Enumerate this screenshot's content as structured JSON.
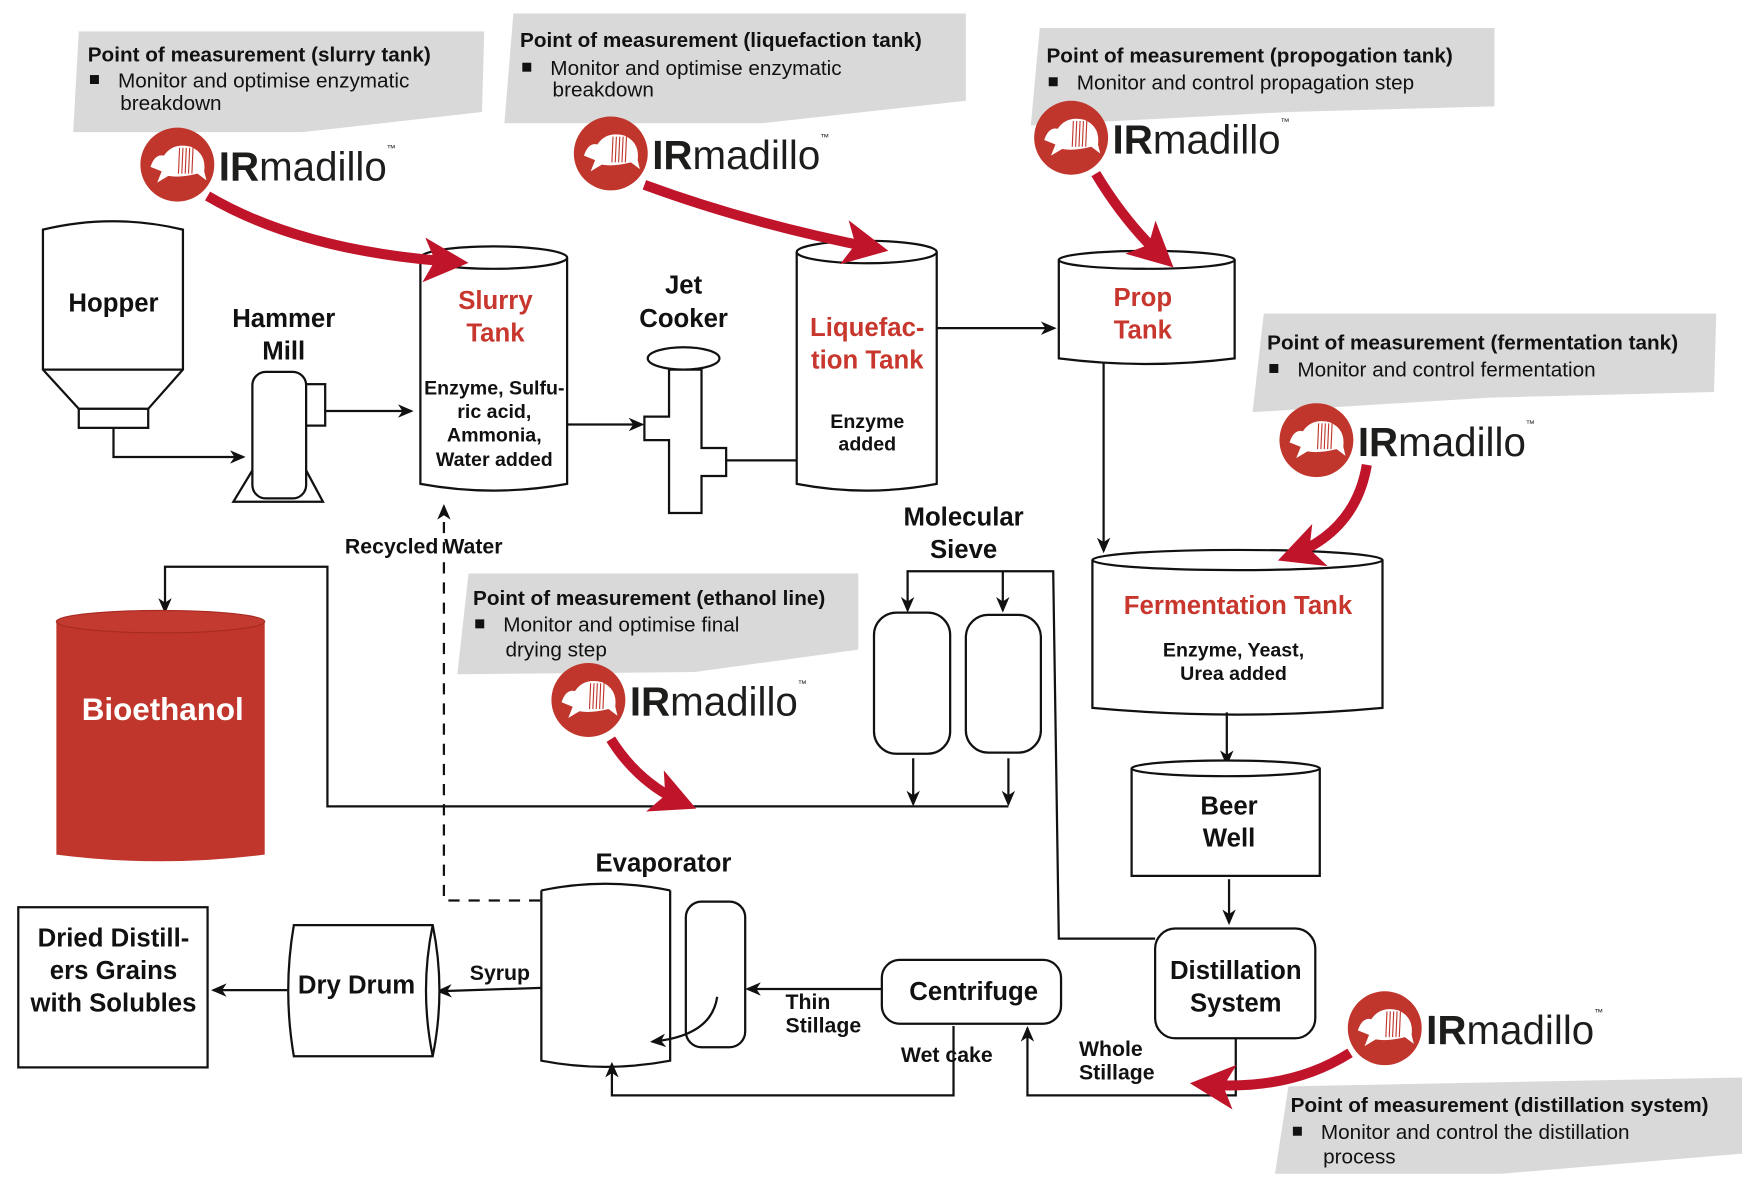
{
  "colors": {
    "brand_red": "#c0362c",
    "arrow_red": "#c0142a",
    "callout_gray": "#d9d9d9",
    "tank_label_red": "#c8372d"
  },
  "brand": {
    "name_bold": "IR",
    "name_rest": "madillo",
    "trademark": "™"
  },
  "callouts": {
    "slurry": {
      "title": "Point of measurement (slurry tank)",
      "lines": [
        "Monitor and optimise enzymatic",
        "breakdown"
      ]
    },
    "liquefaction": {
      "title": "Point of measurement (liquefaction tank)",
      "lines": [
        "Monitor and optimise enzymatic",
        "breakdown"
      ]
    },
    "propagation": {
      "title": "Point of measurement (propogation tank)",
      "lines": [
        "Monitor and control propagation step"
      ]
    },
    "fermentation": {
      "title": "Point of measurement (fermentation tank)",
      "lines": [
        "Monitor and control fermentation"
      ]
    },
    "ethanol": {
      "title": "Point of measurement (ethanol line)",
      "lines": [
        "Monitor and optimise final",
        "drying step"
      ]
    },
    "distillation": {
      "title": "Point of measurement (distillation system)",
      "lines": [
        "Monitor and control the distillation",
        "process"
      ]
    }
  },
  "equipment": {
    "hopper": "Hopper",
    "hammer_mill": [
      "Hammer",
      "Mill"
    ],
    "slurry_tank": {
      "name": [
        "Slurry",
        "Tank"
      ],
      "detail": [
        "Enzyme, Sulfu-",
        "ric acid,",
        "Ammonia,",
        "Water added"
      ]
    },
    "jet_cooker": [
      "Jet",
      "Cooker"
    ],
    "liquefaction_tank": {
      "name": [
        "Liquefac-",
        "tion Tank"
      ],
      "detail": [
        "Enzyme",
        "added"
      ]
    },
    "prop_tank": {
      "name": [
        "Prop",
        "Tank"
      ]
    },
    "fermentation_tank": {
      "name": "Fermentation Tank",
      "detail": [
        "Enzyme, Yeast,",
        "Urea added"
      ]
    },
    "beer_well": [
      "Beer",
      "Well"
    ],
    "distillation_system": [
      "Distillation",
      "System"
    ],
    "molecular_sieve": [
      "Molecular",
      "Sieve"
    ],
    "bioethanol": "Bioethanol",
    "evaporator": "Evaporator",
    "centrifuge": "Centrifuge",
    "dry_drum": "Dry Drum",
    "ddgs": [
      "Dried Distill-",
      "ers Grains",
      "with Solubles"
    ]
  },
  "flows": {
    "recycled_water": "Recycled Water",
    "syrup": "Syrup",
    "thin_stillage": [
      "Thin",
      "Stillage"
    ],
    "wet_cake": "Wet cake",
    "whole_stillage": [
      "Whole",
      "Stillage"
    ]
  }
}
